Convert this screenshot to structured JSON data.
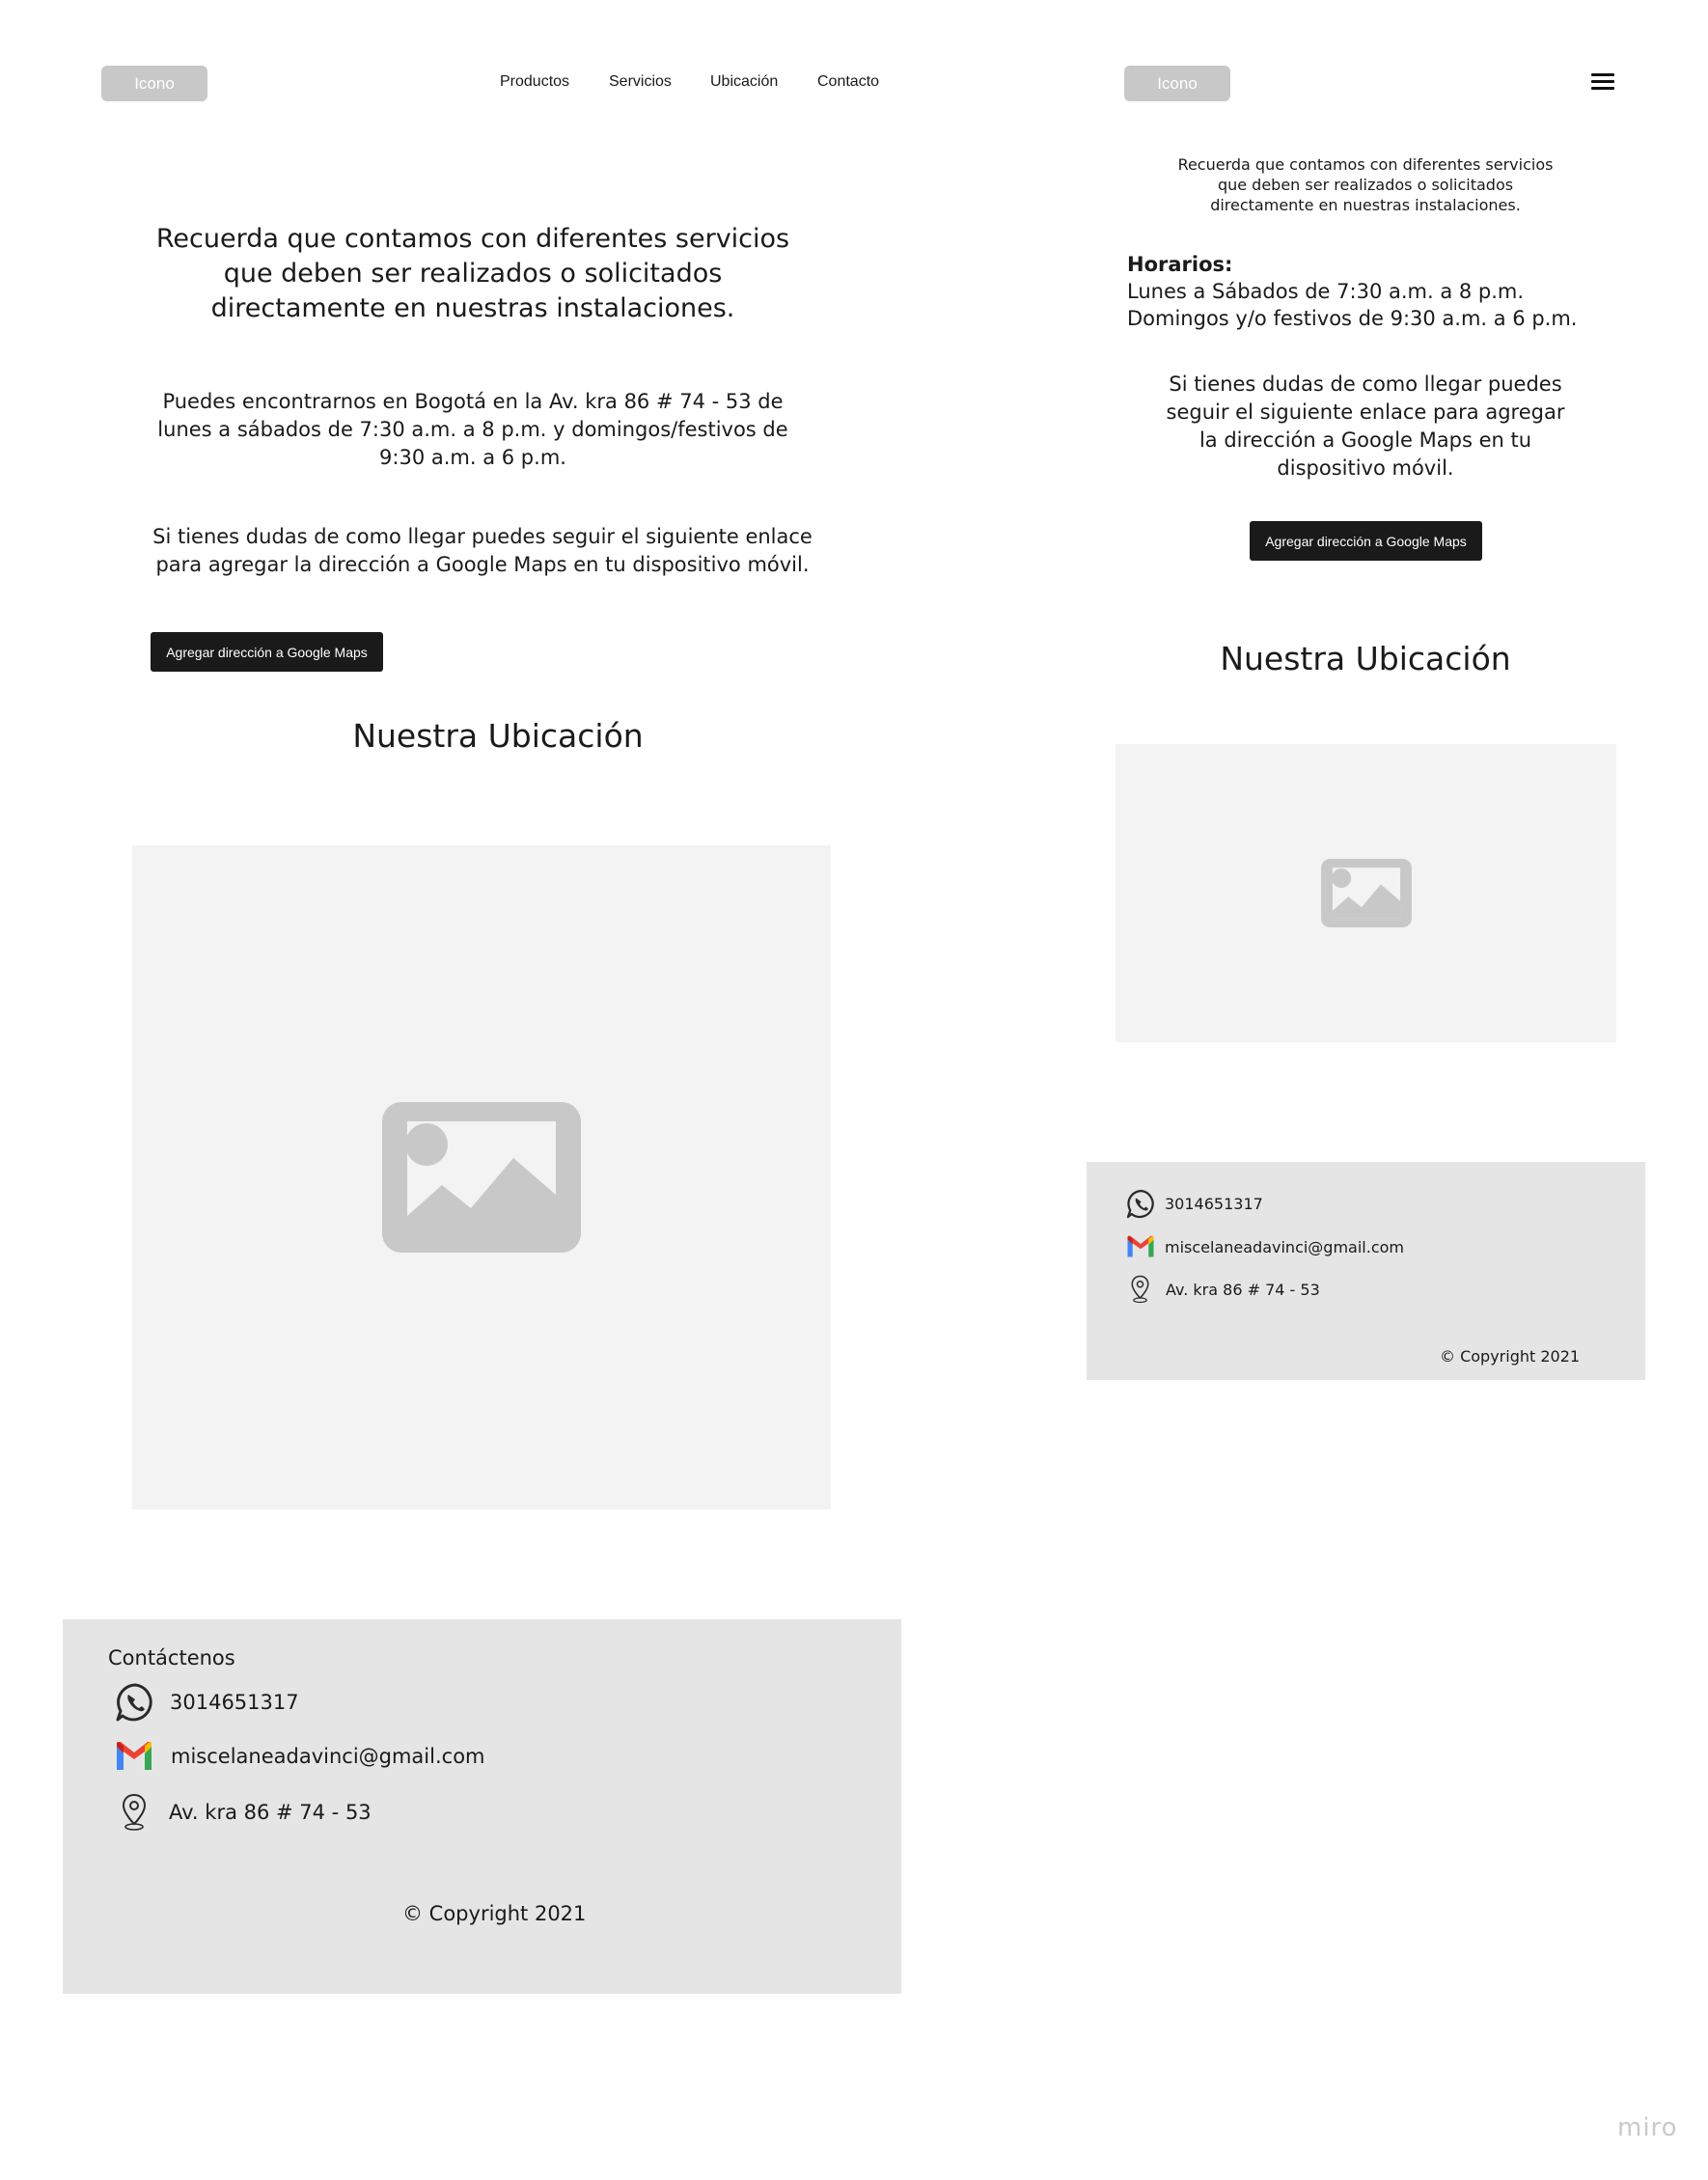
{
  "desktop": {
    "logo_label": "Icono",
    "nav": [
      "Productos",
      "Servicios",
      "Ubicación",
      "Contacto"
    ],
    "intro": "Recuerda que contamos con diferentes servicios que deben ser realizados o solicitados directamente en nuestras instalaciones.",
    "address_info": "Puedes encontrarnos en Bogotá en la Av. kra 86 # 74 - 53 de lunes a sábados de 7:30 a.m. a 8 p.m. y domingos/festivos de 9:30 a.m. a 6 p.m.",
    "directions_text": "Si tienes dudas de como llegar puedes seguir el siguiente enlace para agregar la dirección a Google Maps en tu dispositivo móvil.",
    "maps_button": "Agregar dirección a Google Maps",
    "location_title": "Nuestra Ubicación",
    "footer": {
      "title": "Contáctenos",
      "phone": "3014651317",
      "email": "miscelaneadavinci@gmail.com",
      "address": "Av. kra 86 # 74 - 53",
      "copyright": "© Copyright 2021"
    }
  },
  "mobile": {
    "logo_label": "Icono",
    "intro": "Recuerda que contamos con diferentes servicios que deben ser realizados o solicitados directamente en nuestras instalaciones.",
    "hours_title": "Horarios:",
    "hours_weekdays": "Lunes a Sábados de 7:30 a.m. a 8 p.m.",
    "hours_weekend": "Domingos y/o festivos de 9:30 a.m. a 6 p.m.",
    "directions_text": "Si tienes dudas de como llegar puedes seguir el siguiente enlace para agregar la dirección a Google Maps en tu dispositivo móvil.",
    "maps_button": "Agregar dirección a Google Maps",
    "location_title": "Nuestra Ubicación",
    "footer": {
      "phone": "3014651317",
      "email": "miscelaneadavinci@gmail.com",
      "address": "Av. kra 86 # 74 - 53",
      "copyright": "© Copyright 2021"
    }
  },
  "watermark": "miro",
  "colors": {
    "placeholder_bg": "#f3f3f3",
    "footer_bg": "#e5e5e5",
    "button_bg": "#1a1a1a",
    "logo_bg": "#c8c8c8"
  }
}
